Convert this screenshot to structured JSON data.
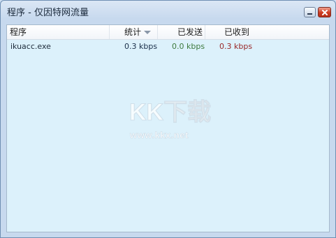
{
  "window": {
    "title": "程序 - 仅因特网流量"
  },
  "columns": {
    "program": "程序",
    "total": "统计",
    "sent": "已发送",
    "received": "已收到"
  },
  "rows": [
    {
      "program": "ikuacc.exe",
      "total": "0.3 kbps",
      "sent": "0.0 kbps",
      "received": "0.3 kbps"
    }
  ],
  "watermark": {
    "logo_text": "KK下载",
    "url": "www.kkx.net"
  },
  "colors": {
    "sent": "#3e7a3e",
    "received": "#9a2a2a",
    "total": "#1a2f4a"
  }
}
